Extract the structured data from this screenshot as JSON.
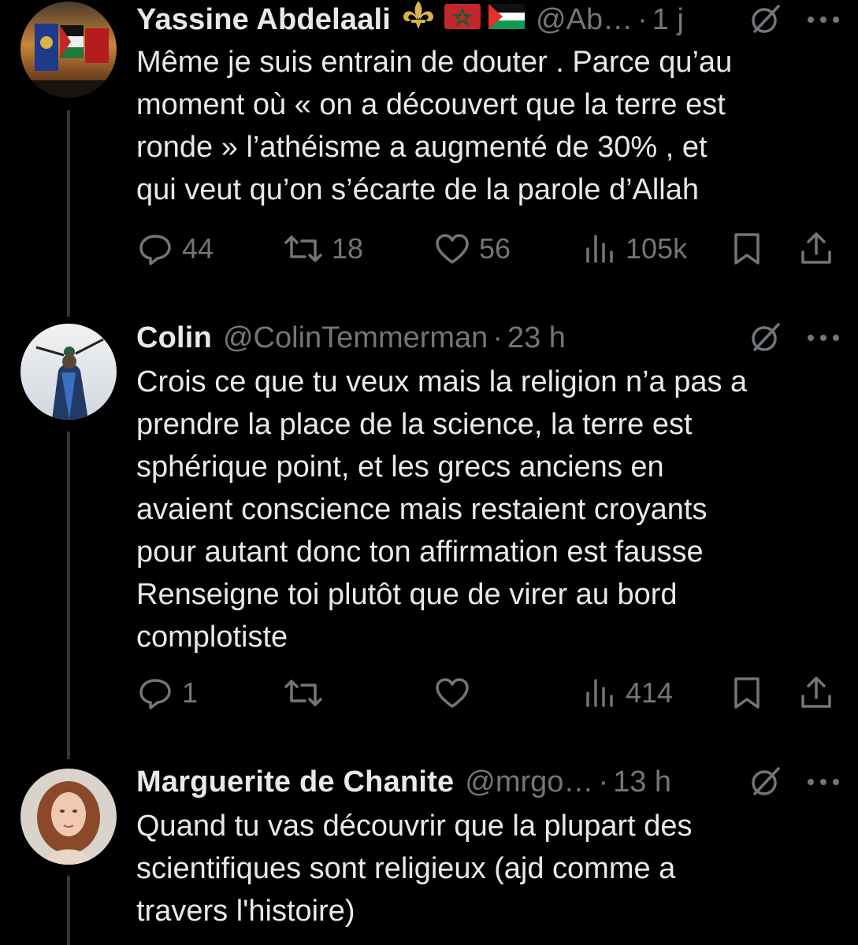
{
  "colors": {
    "background": "#000000",
    "text": "#e7e9ea",
    "muted": "#71767b",
    "thread_line": "#333639"
  },
  "tweets": [
    {
      "author": {
        "name": "Yassine Abdelaali",
        "handle": "@Ab…",
        "badges": [
          "fleur-de-lis-emoji",
          "morocco-flag-emoji",
          "palestine-flag-emoji"
        ]
      },
      "separator": "·",
      "time": "1 j",
      "text": "Même je suis entrain de douter . Parce qu’au\nmoment où « on a découvert que la terre est\nronde » l’athéisme a augmenté de 30% , et\nqui veut qu’on s’écarte de la parole d’Allah",
      "stats": {
        "replies": "44",
        "reposts": "18",
        "likes": "56",
        "views": "105k"
      }
    },
    {
      "author": {
        "name": "Colin",
        "handle": "@ColinTemmerman"
      },
      "separator": "·",
      "time": "23 h",
      "text": "Crois ce que tu veux mais la religion n’a pas a\nprendre la place de la science, la terre est\nsphérique point, et les grecs anciens en\navaient conscience mais restaient croyants\npour autant donc ton affirmation est fausse\nRenseigne toi plutôt que de virer au bord\ncomplotiste",
      "stats": {
        "replies": "1",
        "reposts": "",
        "likes": "",
        "views": "414"
      }
    },
    {
      "author": {
        "name": "Marguerite de Chanite",
        "handle": "@mrgo…"
      },
      "separator": "·",
      "time": "13 h",
      "text": "Quand tu vas découvrir que la plupart des\nscientifiques sont religieux (ajd comme a\ntravers l'histoire)"
    }
  ]
}
